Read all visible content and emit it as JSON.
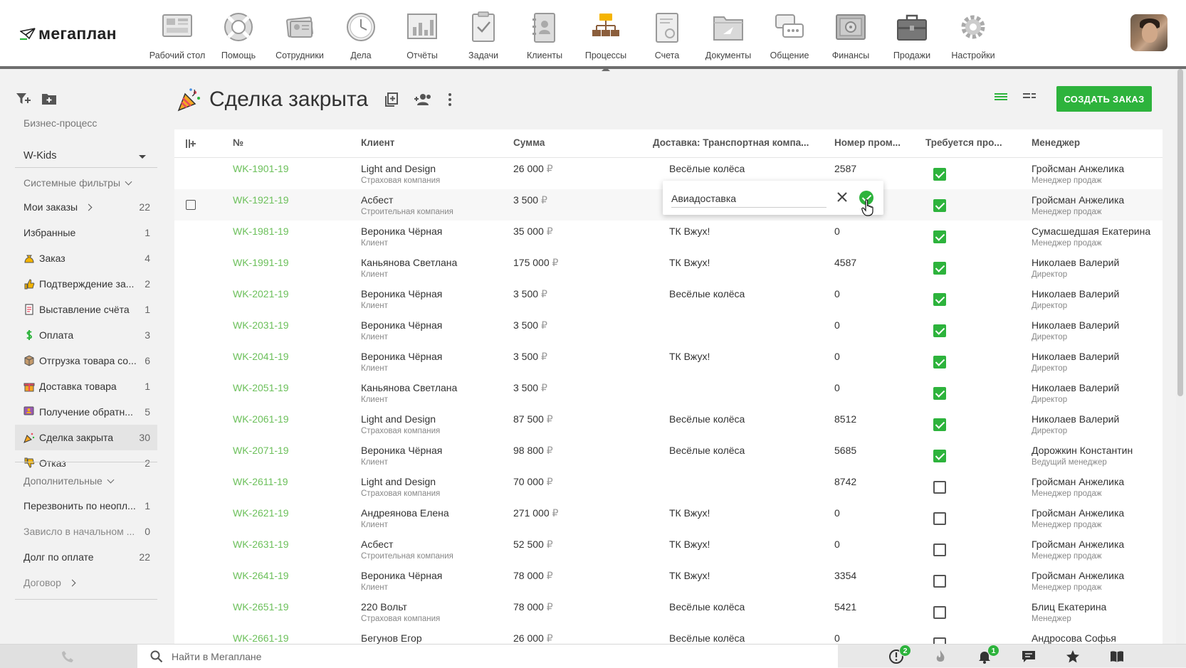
{
  "app": {
    "logo_text": "мегаплан"
  },
  "nav": [
    {
      "label": "Рабочий стол",
      "icon": "desktop-icon"
    },
    {
      "label": "Помощь",
      "icon": "lifebuoy-icon"
    },
    {
      "label": "Сотрудники",
      "icon": "employees-icon"
    },
    {
      "label": "Дела",
      "icon": "clock-icon"
    },
    {
      "label": "Отчёты",
      "icon": "reports-chart-icon"
    },
    {
      "label": "Задачи",
      "icon": "clipboard-check-icon"
    },
    {
      "label": "Клиенты",
      "icon": "contacts-book-icon"
    },
    {
      "label": "Процессы",
      "icon": "process-flow-icon",
      "active": true
    },
    {
      "label": "Счета",
      "icon": "invoice-icon"
    },
    {
      "label": "Документы",
      "icon": "folder-icon"
    },
    {
      "label": "Общение",
      "icon": "chat-bubbles-icon"
    },
    {
      "label": "Финансы",
      "icon": "safe-icon"
    },
    {
      "label": "Продажи",
      "icon": "briefcase-icon"
    },
    {
      "label": "Настройки",
      "icon": "gear-icon"
    }
  ],
  "sidebar": {
    "process_caption": "Бизнес-процесс",
    "process_value": "W-Kids",
    "system_filters_label": "Системные фильтры",
    "system_filters": [
      {
        "label": "Мои заказы",
        "count": "22",
        "chevron": true,
        "icon": ""
      },
      {
        "label": "Избранные",
        "count": "1",
        "icon": ""
      },
      {
        "label": "Заказ",
        "count": "4",
        "icon": "money-bag-icon"
      },
      {
        "label": "Подтверждение за...",
        "count": "2",
        "icon": "thumbs-up-icon"
      },
      {
        "label": "Выставление счёта",
        "count": "1",
        "icon": "invoice-doc-icon"
      },
      {
        "label": "Оплата",
        "count": "3",
        "icon": "dollar-icon"
      },
      {
        "label": "Отгрузка товара со...",
        "count": "6",
        "icon": "box-icon"
      },
      {
        "label": "Доставка товара",
        "count": "1",
        "icon": "gift-icon"
      },
      {
        "label": "Получение обратн...",
        "count": "5",
        "icon": "feedback-icon"
      },
      {
        "label": "Сделка закрыта",
        "count": "30",
        "icon": "party-horn-icon",
        "active": true
      },
      {
        "label": "Отказ",
        "count": "2",
        "icon": "thumbs-down-icon"
      }
    ],
    "extra_filters_label": "Дополнительные",
    "extra_filters": [
      {
        "label": "Перезвонить по неопл...",
        "count": "1"
      },
      {
        "label": "Зависло в начальном ...",
        "count": "0",
        "dim": true
      },
      {
        "label": "Долг по оплате",
        "count": "22"
      },
      {
        "label": "Договор",
        "count": "",
        "chevron": true,
        "dim": true
      }
    ]
  },
  "page": {
    "title": "Сделка закрыта",
    "create_button": "СОЗДАТЬ ЗАКАЗ"
  },
  "table": {
    "headers": {
      "num": "№",
      "client": "Клиент",
      "sum": "Сумма",
      "delivery": "Доставка: Транспортная компа...",
      "nomer": "Номер пром...",
      "required": "Требуется про...",
      "manager": "Менеджер"
    },
    "currency": "₽",
    "rows": [
      {
        "num": "WK-1901-19",
        "client": "Light and Design",
        "client_type": "Страховая компания",
        "sum": "26 000",
        "delivery": "Весёлые колёса",
        "nomer": "2587",
        "checked": true,
        "manager": "Гройсман Анжелика",
        "role": "Менеджер продаж"
      },
      {
        "num": "WK-1921-19",
        "client": "Асбест",
        "client_type": "Строительная компания",
        "sum": "3 500",
        "delivery": "",
        "nomer": "",
        "checked": true,
        "manager": "Гройсман Анжелика",
        "role": "Менеджер продаж",
        "hover": true
      },
      {
        "num": "WK-1981-19",
        "client": "Вероника Чёрная",
        "client_type": "Клиент",
        "sum": "35 000",
        "delivery": "ТК Вжух!",
        "nomer": "0",
        "checked": true,
        "manager": "Сумасшедшая Екатерина",
        "role": "Менеджер продаж"
      },
      {
        "num": "WK-1991-19",
        "client": "Каньянова Светлана",
        "client_type": "Клиент",
        "sum": "175 000",
        "delivery": "ТК Вжух!",
        "nomer": "4587",
        "checked": true,
        "manager": "Николаев Валерий",
        "role": "Директор"
      },
      {
        "num": "WK-2021-19",
        "client": "Вероника Чёрная",
        "client_type": "Клиент",
        "sum": "3 500",
        "delivery": "Весёлые колёса",
        "nomer": "0",
        "checked": true,
        "manager": "Николаев Валерий",
        "role": "Директор"
      },
      {
        "num": "WK-2031-19",
        "client": "Вероника Чёрная",
        "client_type": "Клиент",
        "sum": "3 500",
        "delivery": "",
        "nomer": "0",
        "checked": true,
        "manager": "Николаев Валерий",
        "role": "Директор"
      },
      {
        "num": "WK-2041-19",
        "client": "Вероника Чёрная",
        "client_type": "Клиент",
        "sum": "3 500",
        "delivery": "ТК Вжух!",
        "nomer": "0",
        "checked": true,
        "manager": "Николаев Валерий",
        "role": "Директор"
      },
      {
        "num": "WK-2051-19",
        "client": "Каньянова Светлана",
        "client_type": "Клиент",
        "sum": "3 500",
        "delivery": "",
        "nomer": "0",
        "checked": true,
        "manager": "Николаев Валерий",
        "role": "Директор"
      },
      {
        "num": "WK-2061-19",
        "client": "Light and Design",
        "client_type": "Страховая компания",
        "sum": "87 500",
        "delivery": "Весёлые колёса",
        "nomer": "8512",
        "checked": true,
        "manager": "Николаев Валерий",
        "role": "Директор"
      },
      {
        "num": "WK-2071-19",
        "client": "Вероника Чёрная",
        "client_type": "Клиент",
        "sum": "98 800",
        "delivery": "Весёлые колёса",
        "nomer": "5685",
        "checked": true,
        "manager": "Дорожкин Константин",
        "role": "Ведущий менеджер"
      },
      {
        "num": "WK-2611-19",
        "client": "Light and Design",
        "client_type": "Страховая компания",
        "sum": "70 000",
        "delivery": "",
        "nomer": "8742",
        "checked": false,
        "manager": "Гройсман Анжелика",
        "role": "Менеджер продаж"
      },
      {
        "num": "WK-2621-19",
        "client": "Андреянова Елена",
        "client_type": "Клиент",
        "sum": "271 000",
        "delivery": "ТК Вжух!",
        "nomer": "0",
        "checked": false,
        "manager": "Гройсман Анжелика",
        "role": "Менеджер продаж"
      },
      {
        "num": "WK-2631-19",
        "client": "Асбест",
        "client_type": "Строительная компания",
        "sum": "52 500",
        "delivery": "ТК Вжух!",
        "nomer": "0",
        "checked": false,
        "manager": "Гройсман Анжелика",
        "role": "Менеджер продаж"
      },
      {
        "num": "WK-2641-19",
        "client": "Вероника Чёрная",
        "client_type": "Клиент",
        "sum": "78 000",
        "delivery": "ТК Вжух!",
        "nomer": "3354",
        "checked": false,
        "manager": "Гройсман Анжелика",
        "role": "Менеджер продаж"
      },
      {
        "num": "WK-2651-19",
        "client": "220 Вольт",
        "client_type": "Страховая компания",
        "sum": "78 000",
        "delivery": "Весёлые колёса",
        "nomer": "5421",
        "checked": false,
        "manager": "Блиц Екатерина",
        "role": "Менеджер"
      },
      {
        "num": "WK-2661-19",
        "client": "Бегунов Егор",
        "client_type": "",
        "sum": "26 000",
        "delivery": "Весёлые колёса",
        "nomer": "0",
        "checked": false,
        "manager": "Андросова Софья",
        "role": ""
      }
    ]
  },
  "inline_edit": {
    "value": "Авиадоставка"
  },
  "bottombar": {
    "search_placeholder": "Найти в Мегаплане",
    "icons": [
      {
        "icon": "alert-icon",
        "badge": "2"
      },
      {
        "icon": "fire-icon",
        "badge": ""
      },
      {
        "icon": "bell-icon",
        "badge": "1"
      },
      {
        "icon": "chat-icon",
        "badge": ""
      },
      {
        "icon": "star-icon",
        "badge": ""
      },
      {
        "icon": "book-icon",
        "badge": ""
      }
    ]
  },
  "colors": {
    "accent": "#2db33c",
    "link": "#6cc05b"
  }
}
